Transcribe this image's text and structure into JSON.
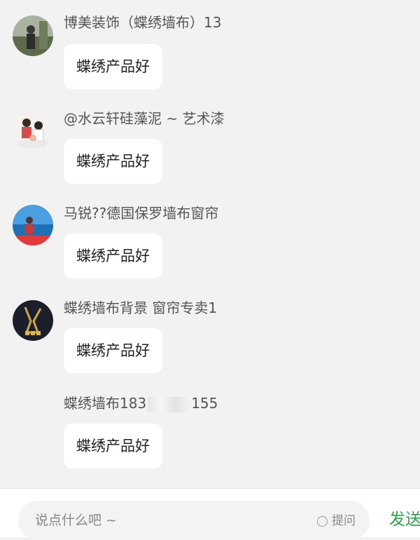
{
  "comments": [
    {
      "name": "博美装饰（蝶绣墙布）13",
      "text": "蝶绣产品好",
      "avatar": "person-outdoor-avatar"
    },
    {
      "name": "@水云轩硅藻泥 ~ 艺术漆",
      "text": "蝶绣产品好",
      "avatar": "family-photo-avatar"
    },
    {
      "name": "马锐??德国保罗墙布窗帘",
      "text": "蝶绣产品好",
      "avatar": "seaside-avatar"
    },
    {
      "name": "蝶绣墙布背景 窗帘专卖1",
      "text": "蝶绣产品好",
      "avatar": "dark-logo-avatar"
    },
    {
      "name_prefix": "蝶绣墙布183",
      "name_suffix": "155",
      "text": "蝶绣产品好"
    }
  ],
  "composer": {
    "placeholder": "说点什么吧 ~",
    "question_label": "提问",
    "send_label": "发送"
  },
  "colors": {
    "send": "#2aa348",
    "background": "#f2f2f2"
  }
}
